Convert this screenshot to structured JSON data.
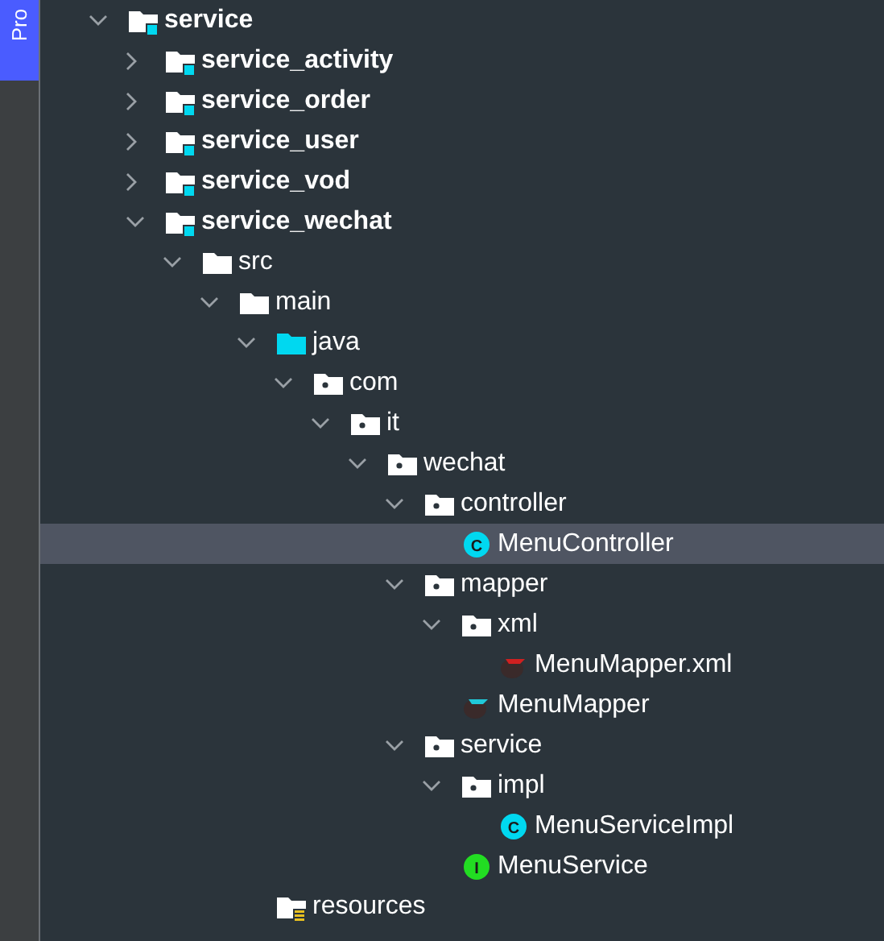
{
  "side_tab": {
    "label": "Pro",
    "selected": true
  },
  "tree": [
    {
      "name": "service",
      "kind": "module",
      "expanded": true,
      "selected": false,
      "children": [
        {
          "name": "service_activity",
          "kind": "module",
          "expanded": false,
          "selected": false
        },
        {
          "name": "service_order",
          "kind": "module",
          "expanded": false,
          "selected": false
        },
        {
          "name": "service_user",
          "kind": "module",
          "expanded": false,
          "selected": false
        },
        {
          "name": "service_vod",
          "kind": "module",
          "expanded": false,
          "selected": false
        },
        {
          "name": "service_wechat",
          "kind": "module",
          "expanded": true,
          "selected": false,
          "children": [
            {
              "name": "src",
              "kind": "folder",
              "expanded": true,
              "selected": false,
              "children": [
                {
                  "name": "main",
                  "kind": "folder",
                  "expanded": true,
                  "selected": false,
                  "children": [
                    {
                      "name": "java",
                      "kind": "source",
                      "expanded": true,
                      "selected": false,
                      "children": [
                        {
                          "name": "com",
                          "kind": "package",
                          "expanded": true,
                          "selected": false,
                          "children": [
                            {
                              "name": "it",
                              "kind": "package",
                              "expanded": true,
                              "selected": false,
                              "children": [
                                {
                                  "name": "wechat",
                                  "kind": "package",
                                  "expanded": true,
                                  "selected": false,
                                  "children": [
                                    {
                                      "name": "controller",
                                      "kind": "package",
                                      "expanded": true,
                                      "selected": false,
                                      "children": [
                                        {
                                          "name": "MenuController",
                                          "kind": "class",
                                          "badge": "C",
                                          "selected": true
                                        }
                                      ]
                                    },
                                    {
                                      "name": "mapper",
                                      "kind": "package",
                                      "expanded": true,
                                      "selected": false,
                                      "children": [
                                        {
                                          "name": "xml",
                                          "kind": "package",
                                          "expanded": true,
                                          "selected": false,
                                          "children": [
                                            {
                                              "name": "MenuMapper.xml",
                                              "kind": "mapper_xml",
                                              "selected": false
                                            }
                                          ]
                                        },
                                        {
                                          "name": "MenuMapper",
                                          "kind": "mapper",
                                          "selected": false
                                        }
                                      ]
                                    },
                                    {
                                      "name": "service",
                                      "kind": "package",
                                      "expanded": true,
                                      "selected": false,
                                      "children": [
                                        {
                                          "name": "impl",
                                          "kind": "package",
                                          "expanded": true,
                                          "selected": false,
                                          "children": [
                                            {
                                              "name": "MenuServiceImpl",
                                              "kind": "class",
                                              "badge": "C",
                                              "selected": false
                                            }
                                          ]
                                        },
                                        {
                                          "name": "MenuService",
                                          "kind": "interface",
                                          "badge": "I",
                                          "selected": false
                                        }
                                      ]
                                    }
                                  ]
                                }
                              ]
                            }
                          ]
                        }
                      ]
                    },
                    {
                      "name": "resources",
                      "kind": "resources",
                      "selected": false
                    }
                  ]
                }
              ]
            }
          ]
        }
      ]
    }
  ]
}
